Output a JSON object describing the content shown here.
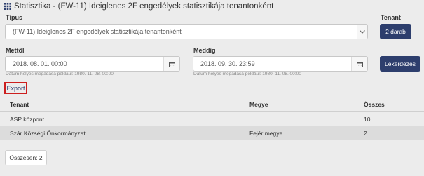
{
  "header": {
    "title": "Statisztika - (FW-11) Ideiglenes 2F engedélyek statisztikája tenantonként",
    "icon": "grid-icon"
  },
  "filters": {
    "tipus_label": "Típus",
    "tipus_value": "(FW-11) Ideiglenes 2F engedélyek statisztikája tenantonként",
    "tenant_label": "Tenant",
    "tenant_button": "2 darab",
    "mettol_label": "Mettől",
    "mettol_value": "2018. 08. 01. 00:00",
    "meddig_label": "Meddig",
    "meddig_value": "2018. 09. 30. 23:59",
    "hint": "Dátum helyes megadása például: 1980. 11. 08. 00:00",
    "query_button": "Lekérdezés"
  },
  "export_label": "Export",
  "table": {
    "columns": [
      "Tenant",
      "Megye",
      "Összes"
    ],
    "rows": [
      {
        "tenant": "ASP központ",
        "megye": "",
        "osszes": "10"
      },
      {
        "tenant": "Szár Községi Önkormányzat",
        "megye": "Fejér megye",
        "osszes": "2"
      }
    ]
  },
  "total": "Összesen: 2",
  "colors": {
    "primary": "#2d3e6d",
    "export_border": "#cc1f1f"
  }
}
